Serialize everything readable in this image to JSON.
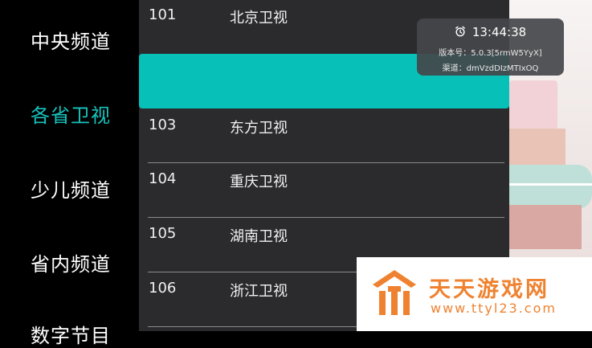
{
  "categories": [
    {
      "label": "中央频道"
    },
    {
      "label": "各省卫视"
    },
    {
      "label": "少儿频道"
    },
    {
      "label": "省内频道"
    },
    {
      "label": "数字节目"
    }
  ],
  "channels": [
    {
      "number": "101",
      "name": "北京卫视"
    },
    {
      "number": "",
      "name": ""
    },
    {
      "number": "103",
      "name": "东方卫视"
    },
    {
      "number": "104",
      "name": "重庆卫视"
    },
    {
      "number": "105",
      "name": "湖南卫视"
    },
    {
      "number": "106",
      "name": "浙江卫视"
    }
  ],
  "info": {
    "time": "13:44:38",
    "version": "版本号：5.0.3[5rmW5YyX]",
    "channel": "渠道：dmVzdDIzMTIxOQ"
  },
  "watermark": {
    "title": "天天游戏网",
    "url": "www.ttyl23.com"
  },
  "colors": {
    "accent": "#07c0b8",
    "active_text": "#16c3bd",
    "watermark": "#ef8230"
  }
}
